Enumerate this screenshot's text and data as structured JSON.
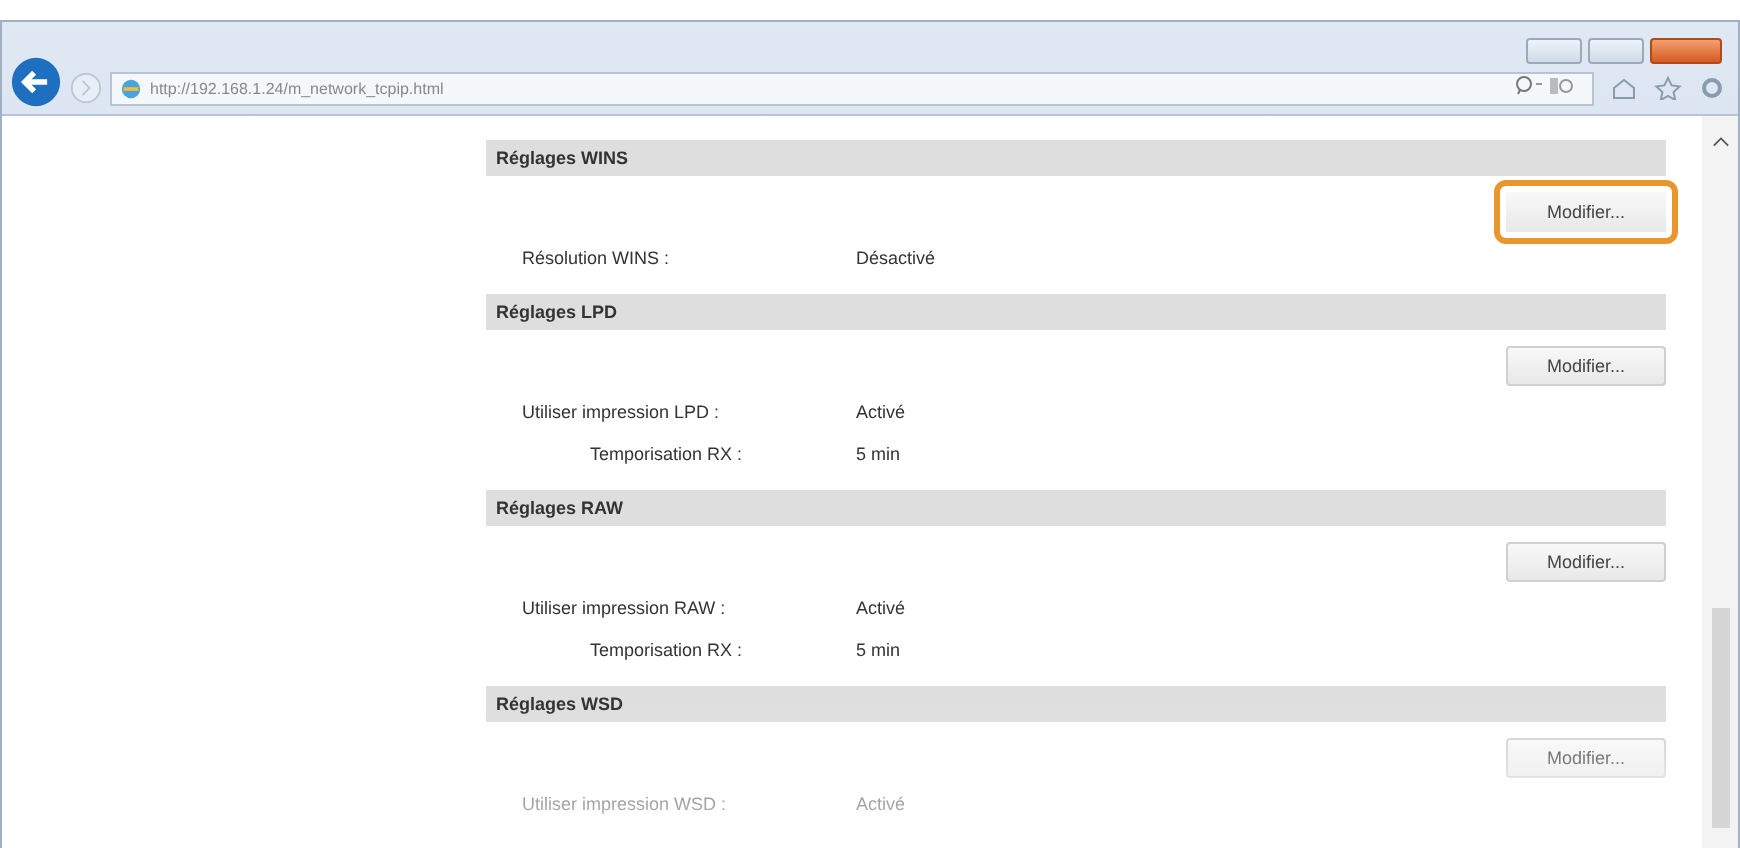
{
  "browser": {
    "address": "http://192.168.1.24/m_network_tcpip.html"
  },
  "sections": [
    {
      "title": "Réglages WINS",
      "button": {
        "label": "Modifier...",
        "highlighted": true
      },
      "rows": [
        {
          "label": "Résolution WINS :",
          "value": "Désactivé"
        }
      ]
    },
    {
      "title": "Réglages LPD",
      "button": {
        "label": "Modifier...",
        "highlighted": false
      },
      "rows": [
        {
          "label": "Utiliser impression LPD :",
          "value": "Activé",
          "children": [
            {
              "label": "Temporisation RX :",
              "value": "5 min"
            }
          ]
        }
      ]
    },
    {
      "title": "Réglages RAW",
      "button": {
        "label": "Modifier...",
        "highlighted": false
      },
      "rows": [
        {
          "label": "Utiliser impression RAW :",
          "value": "Activé",
          "children": [
            {
              "label": "Temporisation RX :",
              "value": "5 min"
            }
          ]
        }
      ]
    },
    {
      "title": "Réglages WSD",
      "button": {
        "label": "Modifier...",
        "highlighted": false
      },
      "rows": [
        {
          "label": "Utiliser impression WSD :",
          "value": "Activé"
        }
      ]
    }
  ]
}
